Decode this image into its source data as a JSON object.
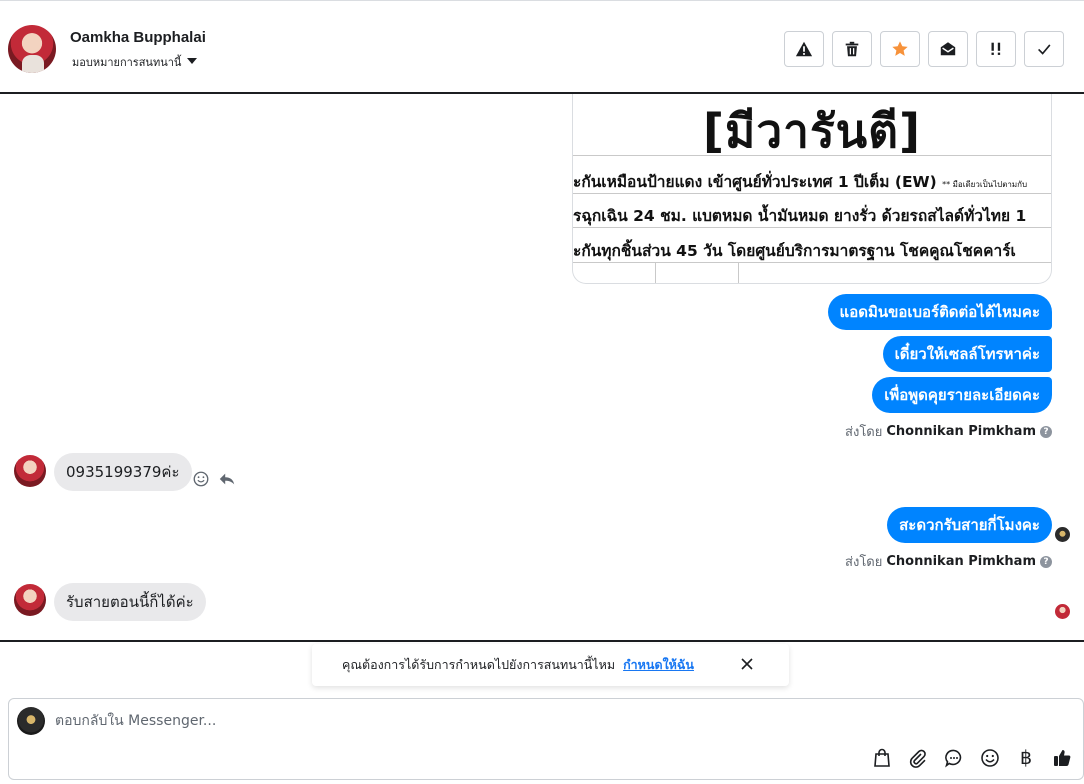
{
  "header": {
    "contact_name": "Oamkha Bupphalai",
    "assign_label": "มอบหมายการสนทนานี้",
    "toolbar": [
      {
        "name": "report-spam-button",
        "icon": "warning-icon"
      },
      {
        "name": "delete-button",
        "icon": "trash-icon"
      },
      {
        "name": "star-button",
        "icon": "star-icon"
      },
      {
        "name": "mark-unread-button",
        "icon": "envelope-open-icon"
      },
      {
        "name": "follow-up-button",
        "icon": "double-exclamation-icon"
      },
      {
        "name": "mark-done-button",
        "icon": "check-icon"
      }
    ]
  },
  "thread": {
    "image_card": {
      "title": "[มีวารันตี]",
      "line1": "ะกันเหมือนป้ายแดง เข้าศูนย์ทั่วประเทศ 1 ปีเต็ม (EW) ",
      "line1_small": "** มือเดียวเป็นไปตามกับ",
      "line2": "รฉุกเฉิน 24 ชม. แบตหมด น้ำมันหมด ยางรั่ว ด้วยรถสไลด์ทั่วไทย 1",
      "line3": "ะกันทุกชิ้นส่วน 45 วัน โดยศูนย์บริการมาตรฐาน โชคคูณโชคคาร์เ"
    },
    "outgoing_group_1": [
      "แอดมินขอเบอร์ติดต่อได้ไหมคะ",
      "เดี๋ยวให้เซลล์โทรหาค่ะ",
      "เพื่อพูดคุยรายละเอียดคะ"
    ],
    "sent_by_prefix": "ส่งโดย",
    "sent_by_name": "Chonnikan Pimkham",
    "help_glyph": "?",
    "incoming_1": "0935199379ค่ะ",
    "outgoing_2": "สะดวกรับสายกี่โมงคะ",
    "incoming_2": "รับสายตอนนี้ก็ได้ค่ะ"
  },
  "follow_up_banner": {
    "text": "คุณต้องการได้รับการกำหนดไปยังการสนทนานี้ไหม",
    "link": "กำหนดให้ฉัน"
  },
  "composer": {
    "placeholder": "ตอบกลับใน Messenger...",
    "tools": [
      "shopping-bag-icon",
      "attachment-icon",
      "saved-reply-icon",
      "emoji-icon",
      "baht-icon",
      "thumbs-up-icon"
    ],
    "baht_glyph": "฿"
  },
  "colors": {
    "outgoing_bubble": "#0084ff",
    "incoming_bubble": "#e9e9eb",
    "star": "#f7923a",
    "link": "#1877f2"
  }
}
